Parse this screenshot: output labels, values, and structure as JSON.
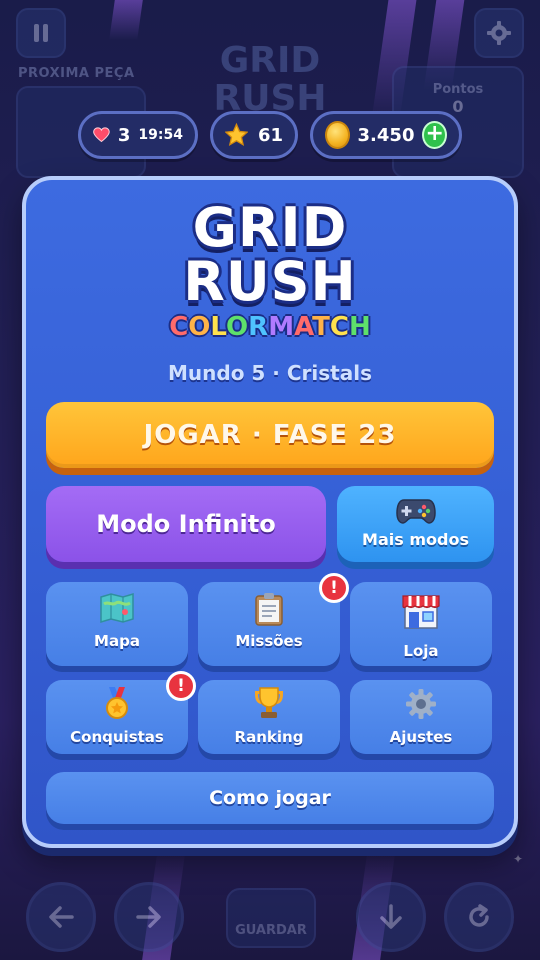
{
  "background": {
    "next_piece_label": "PROXIMA PEÇA",
    "title_line1": "GRID",
    "title_line2": "RUSH",
    "score_label": "Pontos",
    "score_value": "0",
    "save_label": "GUARDAR"
  },
  "resources": {
    "lives": "3",
    "lives_timer": "19:54",
    "stars": "61",
    "coins": "3.450"
  },
  "logo": {
    "line1": "GRID",
    "line2": "RUSH",
    "subtitle_word1": "COLOR",
    "subtitle_word2": "MATCH",
    "subtitle_colors": [
      "#ff6b6b",
      "#ffb347",
      "#ffe14d",
      "#5ee06b",
      "#4fc3ff",
      "#b07bff"
    ]
  },
  "world_label": "Mundo 5 · Cristals",
  "buttons": {
    "play": "JOGAR · FASE 23",
    "infinite": "Modo Infinito",
    "more_modes": "Mais modos",
    "how_to_play": "Como jogar"
  },
  "tiles": [
    {
      "label": "Mapa",
      "icon": "map-icon",
      "badge": false
    },
    {
      "label": "Missões",
      "icon": "clipboard-icon",
      "badge": true
    },
    {
      "label": "Loja",
      "icon": "shop-icon",
      "badge": false
    },
    {
      "label": "Conquistas",
      "icon": "medal-icon",
      "badge": true
    },
    {
      "label": "Ranking",
      "icon": "trophy-icon",
      "badge": false
    },
    {
      "label": "Ajustes",
      "icon": "gear-icon",
      "badge": false
    }
  ],
  "badge_text": "!",
  "colors": {
    "accent_orange": "#ffa51b",
    "accent_purple": "#8b52e8",
    "accent_blue": "#2e93f0",
    "panel_blue": "#3660d6",
    "badge_red": "#e8333f"
  }
}
